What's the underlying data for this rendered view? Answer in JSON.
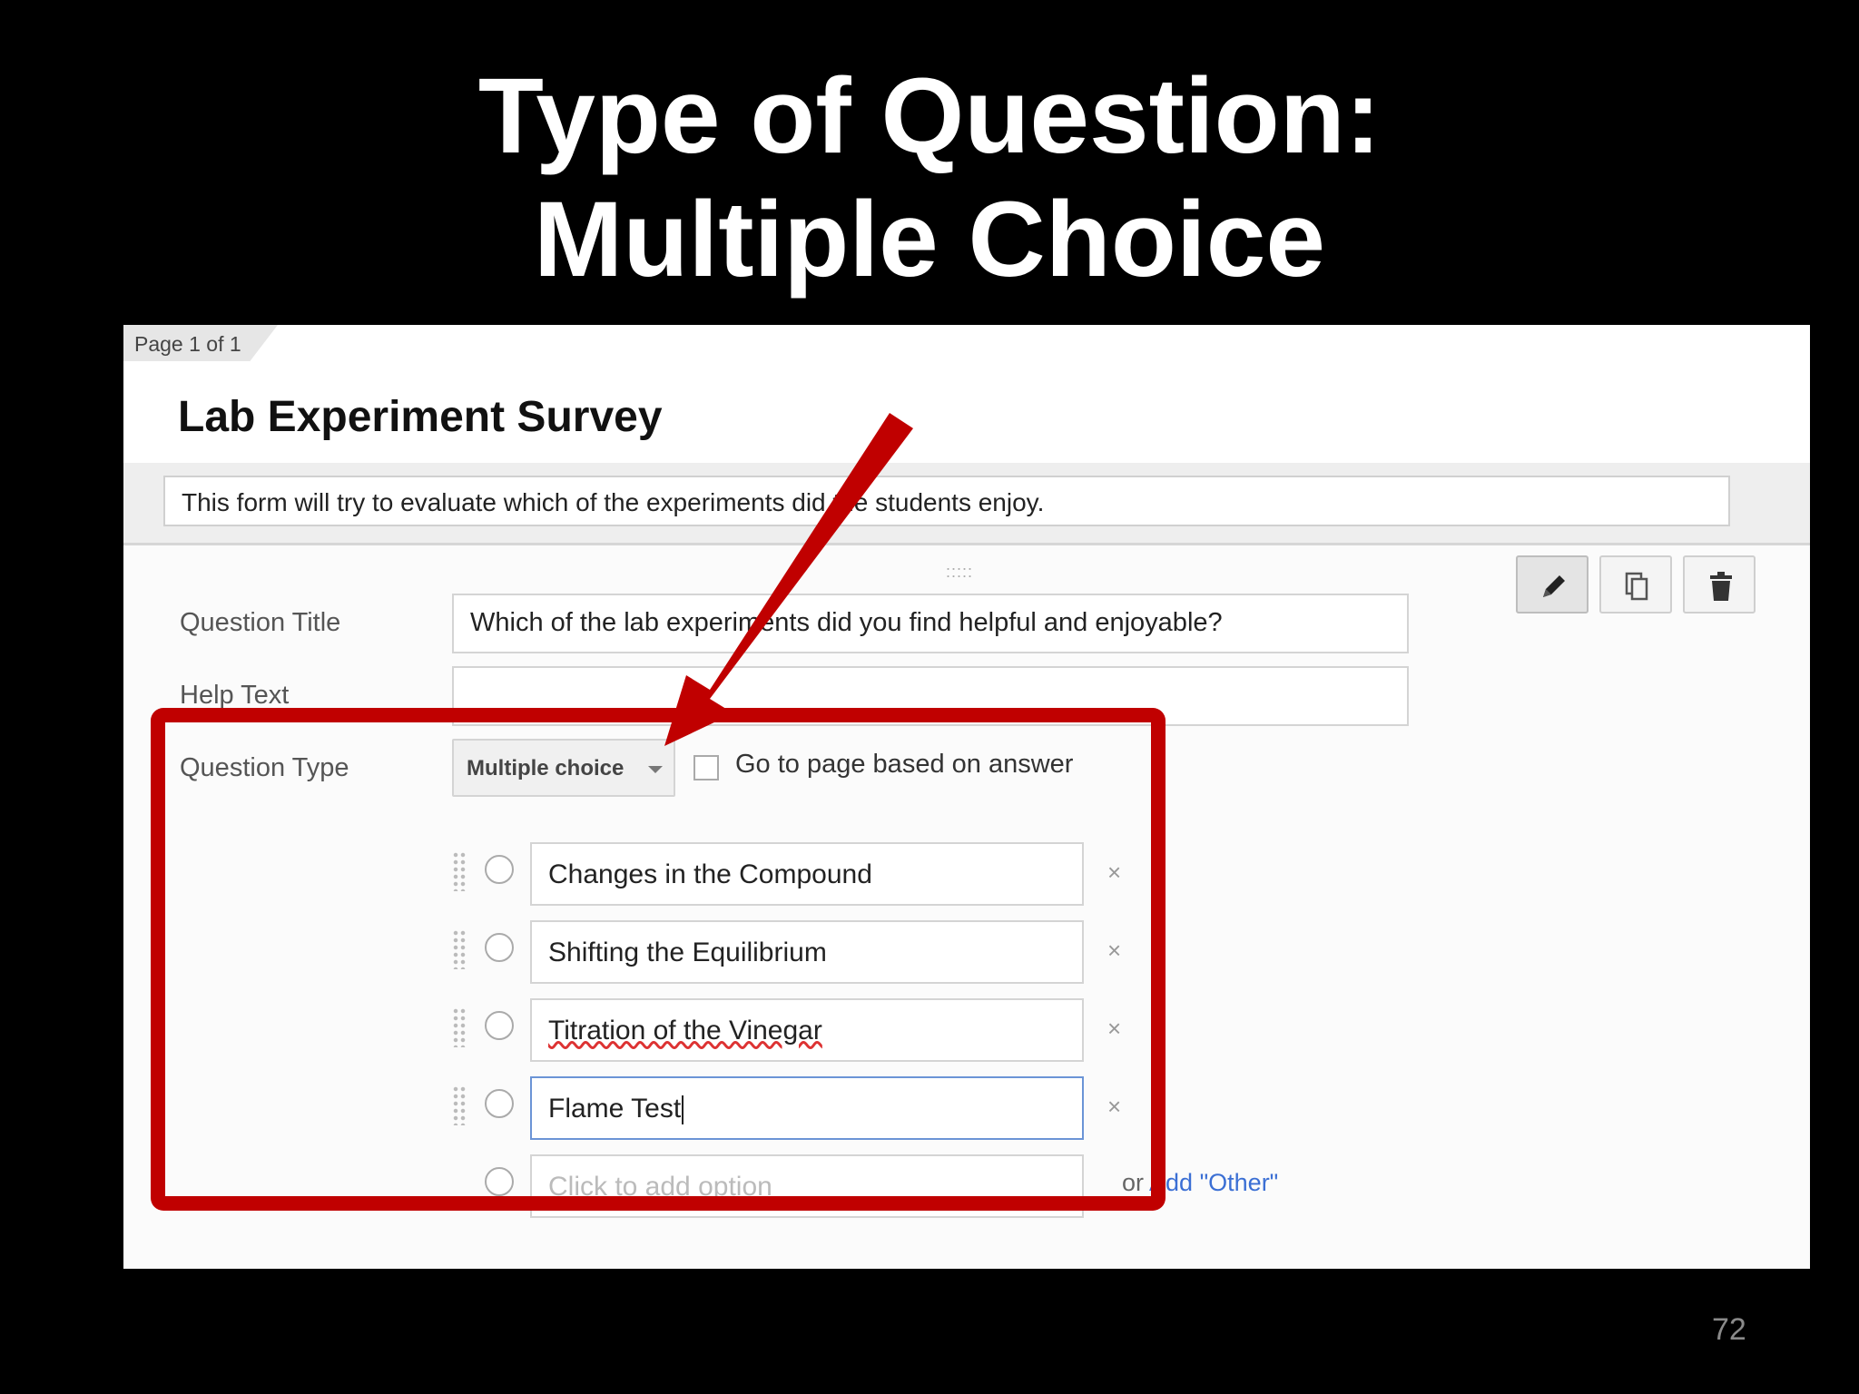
{
  "slide": {
    "title_line1": "Type of Question:",
    "title_line2": "Multiple Choice",
    "number": "72"
  },
  "form": {
    "page_indicator": "Page 1 of 1",
    "title": "Lab Experiment Survey",
    "description": "This form will try to evaluate which of the experiments did the students enjoy."
  },
  "toolbar": {
    "edit_icon": "pencil-icon",
    "duplicate_icon": "duplicate-icon",
    "delete_icon": "trash-icon"
  },
  "question": {
    "title_label": "Question Title",
    "title_value": "Which of the lab experiments did you find helpful and enjoyable?",
    "help_label": "Help Text",
    "help_value": "",
    "type_label": "Question Type",
    "type_value": "Multiple choice",
    "go_to_page_label": "Go to page based on answer",
    "go_to_page_checked": false,
    "options": [
      {
        "label": "Changes in the Compound"
      },
      {
        "label": "Shifting the Equilibrium"
      },
      {
        "label": "Titration of the Vinegar"
      },
      {
        "label": "Flame Test"
      }
    ],
    "add_option_placeholder": "Click to add option",
    "or_text": "or",
    "add_other_link": "Add \"Other\""
  },
  "colors": {
    "highlight": "#c00000",
    "link": "#3b6fd4",
    "focus_border": "#6b94d6"
  }
}
